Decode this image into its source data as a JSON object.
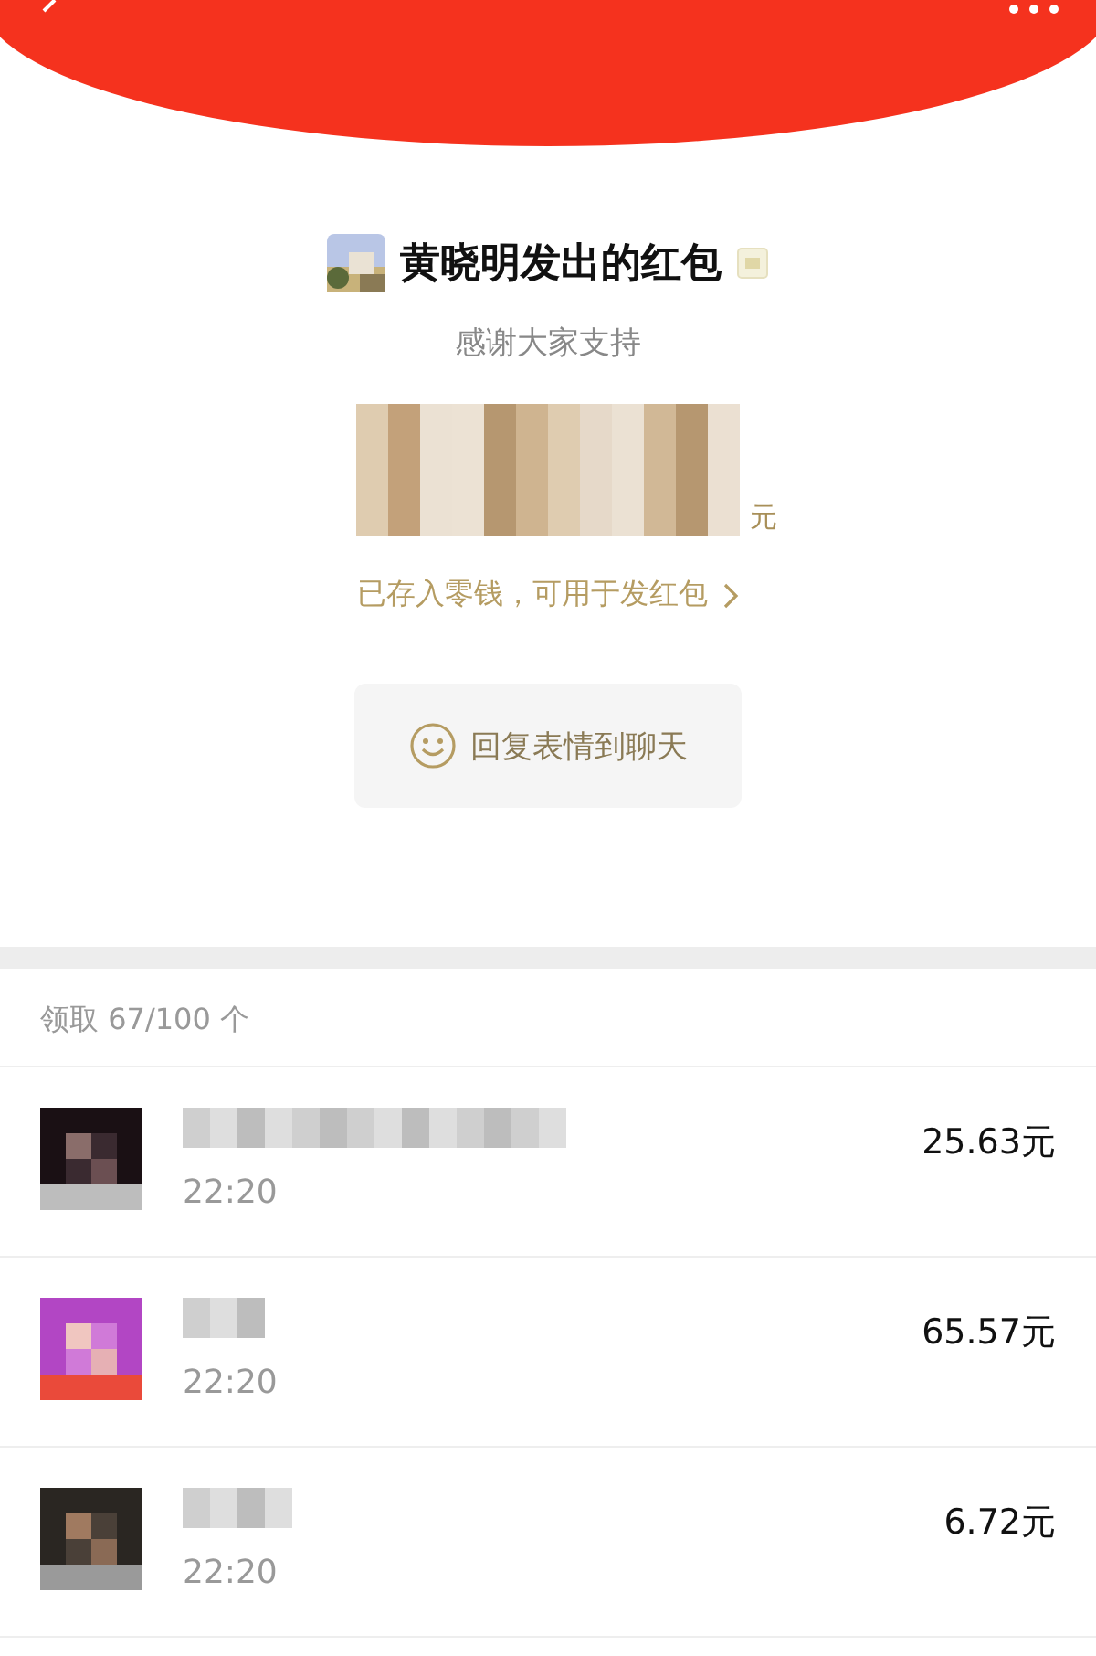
{
  "sender": {
    "title": "黄晓明发出的红包",
    "blessing": "感谢大家支持",
    "amount_unit": "元",
    "note": "已存入零钱，可用于发红包"
  },
  "reply_button": {
    "label": "回复表情到聊天"
  },
  "claims": {
    "summary": "领取 67/100 个",
    "rows": [
      {
        "time": "22:20",
        "amount": "25.63元"
      },
      {
        "time": "22:20",
        "amount": "65.57元"
      },
      {
        "time": "22:20",
        "amount": "6.72元"
      }
    ]
  }
}
